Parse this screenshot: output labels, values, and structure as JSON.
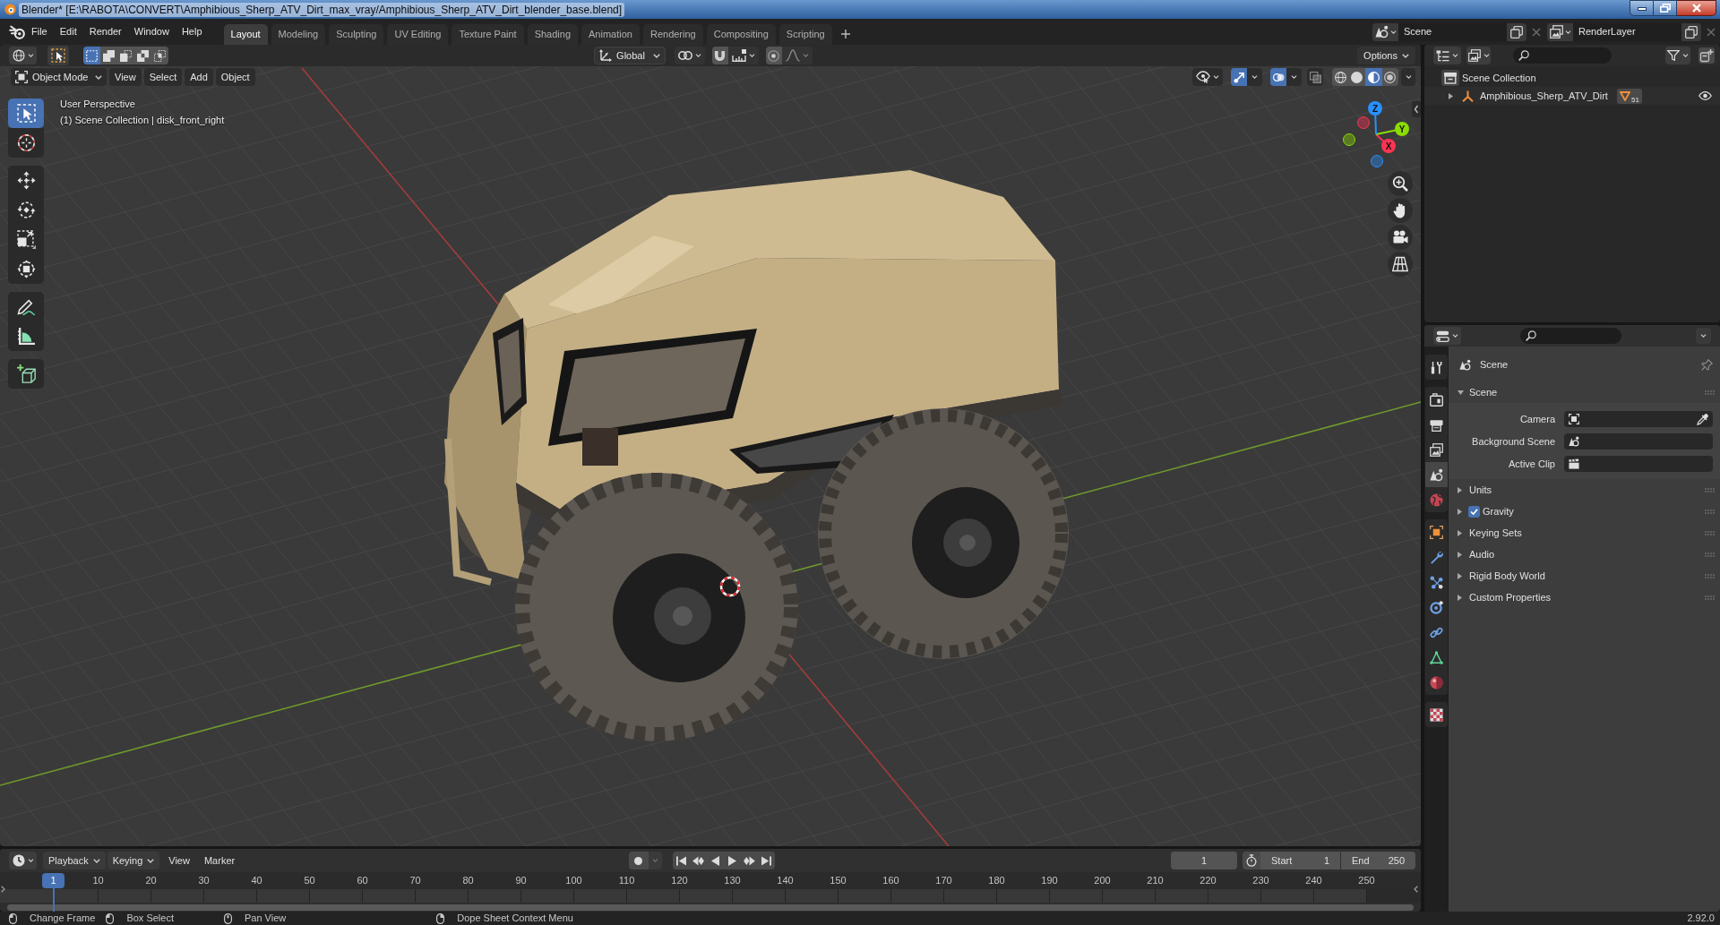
{
  "window": {
    "title": "Blender* [E:\\RABOTA\\CONVERT\\Amphibious_Sherp_ATV_Dirt_max_vray/Amphibious_Sherp_ATV_Dirt_blender_base.blend]"
  },
  "top_bar": {
    "menus": [
      "File",
      "Edit",
      "Render",
      "Window",
      "Help"
    ],
    "workspaces": [
      {
        "label": "Layout",
        "selected": true
      },
      {
        "label": "Modeling",
        "selected": false
      },
      {
        "label": "Sculpting",
        "selected": false
      },
      {
        "label": "UV Editing",
        "selected": false
      },
      {
        "label": "Texture Paint",
        "selected": false
      },
      {
        "label": "Shading",
        "selected": false
      },
      {
        "label": "Animation",
        "selected": false
      },
      {
        "label": "Rendering",
        "selected": false
      },
      {
        "label": "Compositing",
        "selected": false
      },
      {
        "label": "Scripting",
        "selected": false
      }
    ],
    "scene": "Scene",
    "view_layer": "RenderLayer"
  },
  "viewport": {
    "select_modes": [
      {
        "selected": true
      },
      {
        "selected": false
      },
      {
        "selected": false
      },
      {
        "selected": false
      },
      {
        "selected": false
      }
    ],
    "orientation": "Global",
    "snap": {
      "on": false
    },
    "proportional_editing": {
      "on": false
    },
    "options": "Options",
    "mode": "Object Mode",
    "menus": [
      "View",
      "Select",
      "Add",
      "Object"
    ],
    "toggles": [
      {
        "on": true
      },
      {
        "on": true
      },
      {
        "on": false
      }
    ],
    "shading": [
      {
        "selected": false
      },
      {
        "selected": false
      },
      {
        "selected": true
      },
      {
        "selected": false
      }
    ],
    "info": [
      "User Perspective",
      "(1) Scene Collection | disk_front_right"
    ],
    "toolbar": [
      {
        "tools": [
          {
            "selected": true
          },
          {
            "selected": false
          }
        ]
      },
      {
        "tools": [
          {
            "selected": false
          },
          {
            "selected": false
          },
          {
            "selected": false
          },
          {
            "selected": false
          }
        ]
      },
      {
        "tools": [
          {
            "selected": false
          },
          {
            "selected": false
          }
        ]
      },
      {
        "tools": [
          {
            "selected": false
          }
        ]
      }
    ],
    "gizmo_axes": [
      {
        "label": "X",
        "color": "#ff3352"
      },
      {
        "label": "Y",
        "color": "#8bdc00"
      },
      {
        "label": "Z",
        "color": "#2890ff"
      }
    ]
  },
  "outliner": {
    "items": [
      {
        "label": "Scene Collection",
        "children": [
          {
            "label": "Amphibious_Sherp_ATV_Dirt",
            "expanded": false,
            "badge_count": "51",
            "visible": true
          }
        ]
      }
    ]
  },
  "properties": {
    "tab_groups": [
      {
        "tabs": [
          {
            "selected": false
          }
        ]
      },
      {
        "tabs": [
          {
            "selected": false
          },
          {
            "selected": false
          },
          {
            "selected": false
          },
          {
            "selected": true
          },
          {
            "selected": false
          }
        ]
      },
      {
        "tabs": [
          {
            "selected": false
          },
          {
            "selected": false
          },
          {
            "selected": false
          },
          {
            "selected": false
          },
          {
            "selected": false
          },
          {
            "selected": false
          },
          {
            "selected": false
          }
        ]
      },
      {
        "tabs": [
          {
            "selected": false
          }
        ]
      }
    ],
    "context": "Scene",
    "panels": [
      {
        "title": "Scene",
        "kind": "plain",
        "expanded": true,
        "fields": [
          {
            "label": "Camera",
            "kind": "object"
          },
          {
            "label": "Background Scene",
            "kind": "scene"
          },
          {
            "label": "Active Clip",
            "kind": "clip"
          }
        ]
      },
      {
        "title": "Units",
        "kind": "plain",
        "expanded": false
      },
      {
        "title": "Gravity",
        "kind": "toggle",
        "checked": true,
        "expanded": false
      },
      {
        "title": "Keying Sets",
        "kind": "plain",
        "expanded": false
      },
      {
        "title": "Audio",
        "kind": "plain",
        "expanded": false
      },
      {
        "title": "Rigid Body World",
        "kind": "plain",
        "expanded": false
      },
      {
        "title": "Custom Properties",
        "kind": "plain",
        "expanded": false
      }
    ]
  },
  "timeline": {
    "menus": [
      {
        "label": "Playback",
        "kind": "dropdown"
      },
      {
        "label": "Keying",
        "kind": "dropdown"
      },
      {
        "label": "View",
        "kind": "menu"
      },
      {
        "label": "Marker",
        "kind": "menu"
      }
    ],
    "auto_keying": {
      "on": false
    },
    "frame": "1",
    "start": {
      "label": "Start",
      "value": "1"
    },
    "end": {
      "label": "End",
      "value": "250"
    },
    "current_frame": "1",
    "ruler": [
      "10",
      "20",
      "30",
      "40",
      "50",
      "60",
      "70",
      "80",
      "90",
      "100",
      "110",
      "120",
      "130",
      "140",
      "150",
      "160",
      "170",
      "180",
      "190",
      "200",
      "210",
      "220",
      "230",
      "240",
      "250"
    ]
  },
  "status_bar": {
    "hints": [
      "Change Frame",
      "Box Select",
      "Pan View",
      "Dope Sheet Context Menu"
    ],
    "version": "2.92.0"
  }
}
